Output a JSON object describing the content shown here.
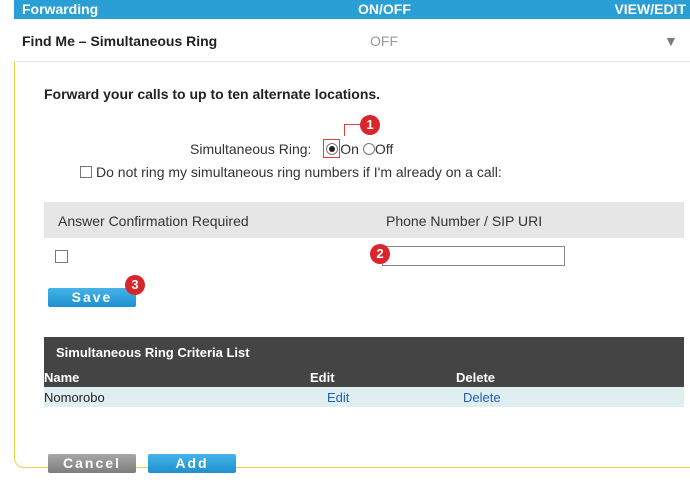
{
  "header": {
    "col1": "Forwarding",
    "col2": "ON/OFF",
    "col3": "VIEW/EDIT"
  },
  "section": {
    "title": "Find Me – Simultaneous Ring",
    "state": "OFF",
    "expand_glyph": "▼"
  },
  "intro": "Forward your calls to up to ten alternate locations.",
  "simultaneous_ring": {
    "label": "Simultaneous Ring:",
    "on_label": "On",
    "off_label": "Off",
    "selected": "On"
  },
  "busy_option": {
    "label": "Do not ring my simultaneous ring numbers if I'm already on a call:",
    "checked": false
  },
  "answer_table": {
    "col1": "Answer Confirmation Required",
    "col2": "Phone Number / SIP URI",
    "row": {
      "confirm_checked": false,
      "phone_value": ""
    }
  },
  "buttons": {
    "save": "Save",
    "cancel": "Cancel",
    "add": "Add"
  },
  "badges": {
    "b1": "1",
    "b2": "2",
    "b3": "3"
  },
  "criteria": {
    "title": "Simultaneous Ring Criteria List",
    "columns": [
      "Name",
      "Edit",
      "Delete"
    ],
    "rows": [
      {
        "name": "Nomorobo",
        "edit": "Edit",
        "delete": "Delete"
      }
    ]
  },
  "colors": {
    "accent": "#2a9fd6",
    "badge": "#d9262c",
    "table_header": "#444444",
    "row_bg": "#dfeff1"
  }
}
